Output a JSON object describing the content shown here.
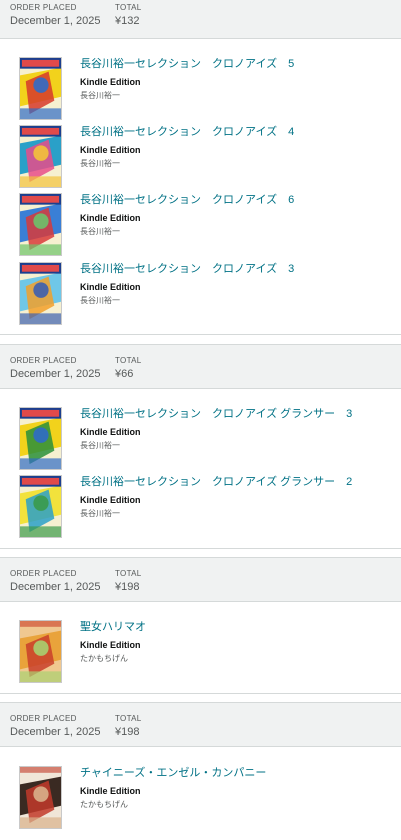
{
  "orders": [
    {
      "placed_label": "ORDER PLACED",
      "placed_date": "December 1, 2025",
      "total_label": "TOTAL",
      "total": "¥132",
      "items": [
        {
          "title": "長谷川裕一セレクション　クロノアイズ　5",
          "format": "Kindle Edition",
          "author": "長谷川裕一",
          "cover_palette": [
            "#f2d21c",
            "#d63a2a",
            "#2f6bc6",
            "#f6f0d0"
          ],
          "cover_name": "CHRONO EYES"
        },
        {
          "title": "長谷川裕一セレクション　クロノアイズ　4",
          "format": "Kindle Edition",
          "author": "長谷川裕一",
          "cover_palette": [
            "#2aa0c8",
            "#e84c8a",
            "#f3c23a",
            "#f6f0d0"
          ],
          "cover_name": "CHRONO EYES"
        },
        {
          "title": "長谷川裕一セレクション　クロノアイズ　6",
          "format": "Kindle Edition",
          "author": "長谷川裕一",
          "cover_palette": [
            "#3a7fd6",
            "#d83a3a",
            "#6cc36a",
            "#f6f0d0"
          ],
          "cover_name": "CHRONO EYES"
        },
        {
          "title": "長谷川裕一セレクション　クロノアイズ　3",
          "format": "Kindle Edition",
          "author": "長谷川裕一",
          "cover_palette": [
            "#6fc7e8",
            "#f2a02a",
            "#3c5fb0",
            "#f6f0d0"
          ],
          "cover_name": "CHRONO EYES"
        }
      ]
    },
    {
      "placed_label": "ORDER PLACED",
      "placed_date": "December 1, 2025",
      "total_label": "TOTAL",
      "total": "¥66",
      "items": [
        {
          "title": "長谷川裕一セレクション　クロノアイズ グランサー　3",
          "format": "Kindle Edition",
          "author": "長谷川裕一",
          "cover_palette": [
            "#f2d21c",
            "#2a8f3a",
            "#2f6bc6",
            "#f6f0d0"
          ],
          "cover_name": "GRANSER"
        },
        {
          "title": "長谷川裕一セレクション　クロノアイズ グランサー　2",
          "format": "Kindle Edition",
          "author": "長谷川裕一",
          "cover_palette": [
            "#f2e23c",
            "#2aa0c8",
            "#3a9a4a",
            "#f6f0d0"
          ],
          "cover_name": "GRANSER"
        }
      ]
    },
    {
      "placed_label": "ORDER PLACED",
      "placed_date": "December 1, 2025",
      "total_label": "TOTAL",
      "total": "¥198",
      "items": [
        {
          "title": "聖女ハリマオ",
          "format": "Kindle Edition",
          "author": "たかもちげん",
          "cover_palette": [
            "#e9a33b",
            "#c9402a",
            "#a9d070",
            "#f0c890"
          ],
          "cover_name": ""
        }
      ]
    },
    {
      "placed_label": "ORDER PLACED",
      "placed_date": "December 1, 2025",
      "total_label": "TOTAL",
      "total": "¥198",
      "items": [
        {
          "title": "チャイニーズ・エンゼル・カンパニー",
          "format": "Kindle Edition",
          "author": "たかもちげん",
          "cover_palette": [
            "#3a2a22",
            "#c23a2a",
            "#d9b08a",
            "#f0e6d8"
          ],
          "cover_name": ""
        }
      ]
    }
  ]
}
